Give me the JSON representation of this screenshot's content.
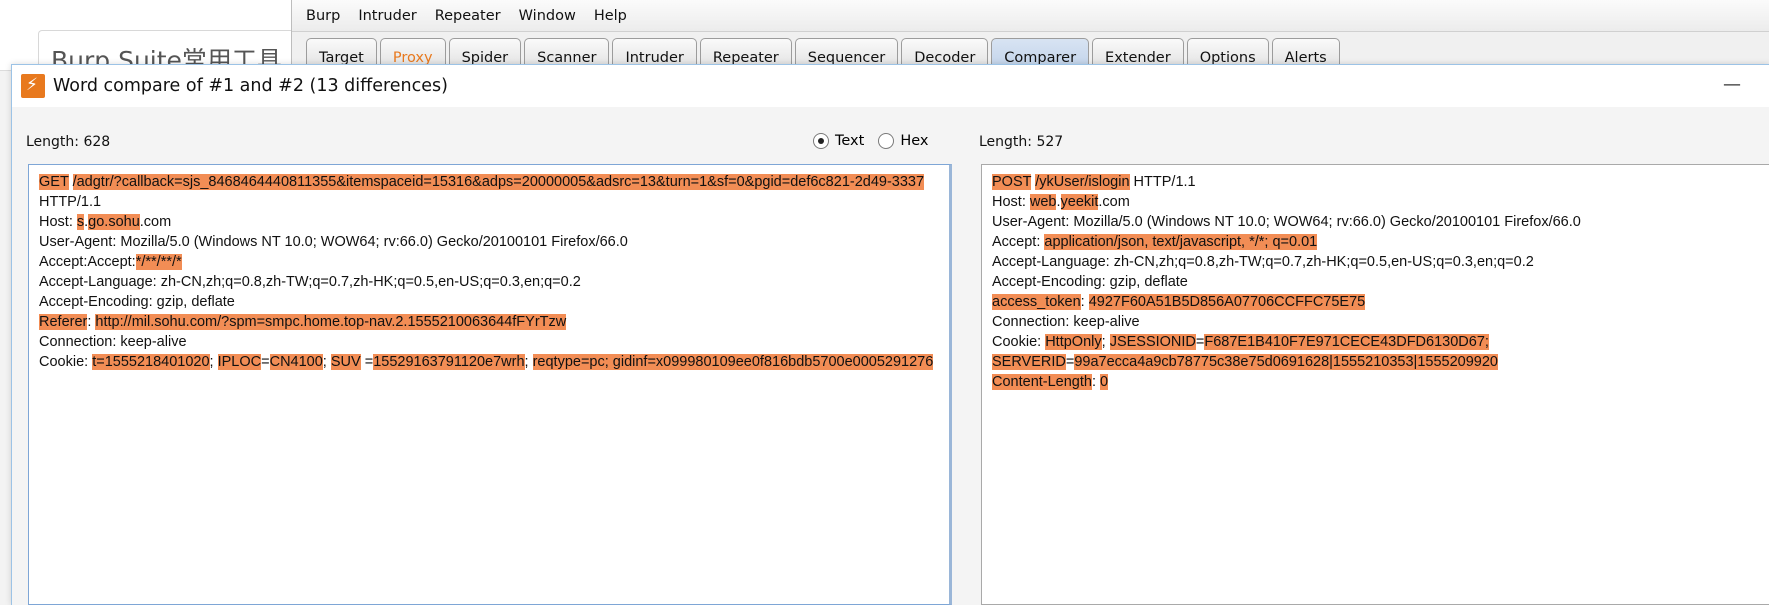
{
  "background_page": {
    "title": "Burp Suite常用工具"
  },
  "burp": {
    "menu": [
      "Burp",
      "Intruder",
      "Repeater",
      "Window",
      "Help"
    ],
    "tabs": [
      "Target",
      "Proxy",
      "Spider",
      "Scanner",
      "Intruder",
      "Repeater",
      "Sequencer",
      "Decoder",
      "Comparer",
      "Extender",
      "Options",
      "Alerts"
    ],
    "active_tab": "Comparer"
  },
  "dialog": {
    "title": "Word compare of #1 and #2  (13 differences)",
    "minimize_label": "—",
    "left_length": "Length: 628",
    "right_length": "Length: 527",
    "mode_options": [
      "Text",
      "Hex"
    ],
    "selected_mode": "Text",
    "highlight_color": "#f28d55"
  },
  "left_lines": [
    [
      [
        "GET",
        true
      ],
      [
        " ",
        false
      ],
      [
        "/adgtr/?callback=sjs_8468464440811355&itemspaceid=15316&adps=20000005&adsrc=13&turn=1&sf=0&pgid=def6c821-2d49-3337",
        true
      ]
    ],
    [
      [
        "HTTP/1.1",
        false
      ]
    ],
    [
      [
        "Host: ",
        false
      ],
      [
        "s",
        true
      ],
      [
        ".",
        false
      ],
      [
        "go.sohu",
        true
      ],
      [
        ".com",
        false
      ]
    ],
    [
      [
        "User-Agent: Mozilla/5.0 (Windows NT 10.0; WOW64; rv:66.0) Gecko/20100101 Firefox/66.0",
        false
      ]
    ],
    [
      [
        "Accept:Accept:",
        false
      ],
      [
        "*/**/**/*",
        true
      ]
    ],
    [
      [
        "Accept-Language: zh-CN,zh;q=0.8,zh-TW;q=0.7,zh-HK;q=0.5,en-US;q=0.3,en;q=0.2",
        false
      ]
    ],
    [
      [
        "Accept-Encoding: gzip, deflate",
        false
      ]
    ],
    [
      [
        "Referer",
        true
      ],
      [
        ": ",
        false
      ],
      [
        "http://mil.sohu.com/?spm=smpc.home.top-nav.2.1555210063644fFYrTzw",
        true
      ]
    ],
    [
      [
        "Connection: keep-alive",
        false
      ]
    ],
    [
      [
        "Cookie: ",
        false
      ],
      [
        "t=1555218401020",
        true
      ],
      [
        "; ",
        false
      ],
      [
        "IPLOC",
        true
      ],
      [
        "=",
        false
      ],
      [
        "CN4100",
        true
      ],
      [
        "; ",
        false
      ],
      [
        "SUV",
        true
      ],
      [
        " =",
        false
      ],
      [
        "15529163791120e7wrh",
        true
      ],
      [
        "; ",
        false
      ],
      [
        "reqtype=pc; gidinf=x099980109ee0f816bdb5700e0005291276",
        true
      ]
    ]
  ],
  "right_lines": [
    [
      [
        "POST",
        true
      ],
      [
        " ",
        false
      ],
      [
        "/ykUser/islogin",
        true
      ],
      [
        " HTTP/1.1",
        false
      ]
    ],
    [
      [
        "Host: ",
        false
      ],
      [
        "web",
        true
      ],
      [
        ".",
        false
      ],
      [
        "yeekit",
        true
      ],
      [
        ".com",
        false
      ]
    ],
    [
      [
        "User-Agent: Mozilla/5.0 (Windows NT 10.0; WOW64; rv:66.0) Gecko/20100101 Firefox/66.0",
        false
      ]
    ],
    [
      [
        "Accept: ",
        false
      ],
      [
        "application/json, text/javascript, */*; q=0.01",
        true
      ]
    ],
    [
      [
        "Accept-Language: zh-CN,zh;q=0.8,zh-TW;q=0.7,zh-HK;q=0.5,en-US;q=0.3,en;q=0.2",
        false
      ]
    ],
    [
      [
        "Accept-Encoding: gzip, deflate",
        false
      ]
    ],
    [
      [
        "access_token",
        true
      ],
      [
        ": ",
        false
      ],
      [
        "4927F60A51B5D856A07706CCFFC75E75",
        true
      ]
    ],
    [
      [
        "Connection: keep-alive",
        false
      ]
    ],
    [
      [
        "Cookie: ",
        false
      ],
      [
        "HttpOnly",
        true
      ],
      [
        "; ",
        false
      ],
      [
        "JSESSIONID",
        true
      ],
      [
        "=",
        false
      ],
      [
        "F687E1B410F7E971CECE43DFD6130D67;",
        true
      ]
    ],
    [
      [
        "SERVERID",
        true
      ],
      [
        "=",
        false
      ],
      [
        "99a7ecca4a9cb78775c38e75d0691628|1555210353|1555209920",
        true
      ]
    ],
    [
      [
        "Content-Length",
        true
      ],
      [
        ": ",
        false
      ],
      [
        "0",
        true
      ]
    ]
  ]
}
